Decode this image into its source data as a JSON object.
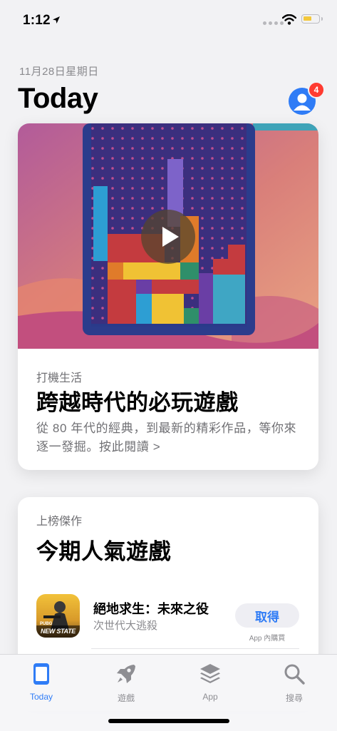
{
  "status_bar": {
    "time": "1:12"
  },
  "header": {
    "date": "11月28日星期日",
    "title": "Today",
    "badge_count": "4"
  },
  "feature_card": {
    "eyebrow": "打機生活",
    "headline": "跨越時代的必玩遊戲",
    "description": "從 80 年代的經典，到最新的精彩作品，等你來逐一發掘。按此閱讀 >"
  },
  "top_charts_card": {
    "eyebrow": "上榜傑作",
    "headline": "今期人氣遊戲",
    "app": {
      "name": "絕地求生：未來之役",
      "subtitle": "次世代大逃殺",
      "get_label": "取得",
      "iap_label": "App 內購買",
      "icon_text_small": "PUBG",
      "icon_text": "NEW STATE"
    }
  },
  "tab_bar": {
    "tabs": [
      {
        "label": "Today",
        "icon": "today-icon",
        "active": true
      },
      {
        "label": "遊戲",
        "icon": "rocket-icon",
        "active": false
      },
      {
        "label": "App",
        "icon": "stack-icon",
        "active": false
      },
      {
        "label": "搜尋",
        "icon": "search-icon",
        "active": false
      }
    ]
  },
  "colors": {
    "accent": "#2f7cf6",
    "badge": "#ff3b30",
    "battery": "#f3c83c"
  }
}
